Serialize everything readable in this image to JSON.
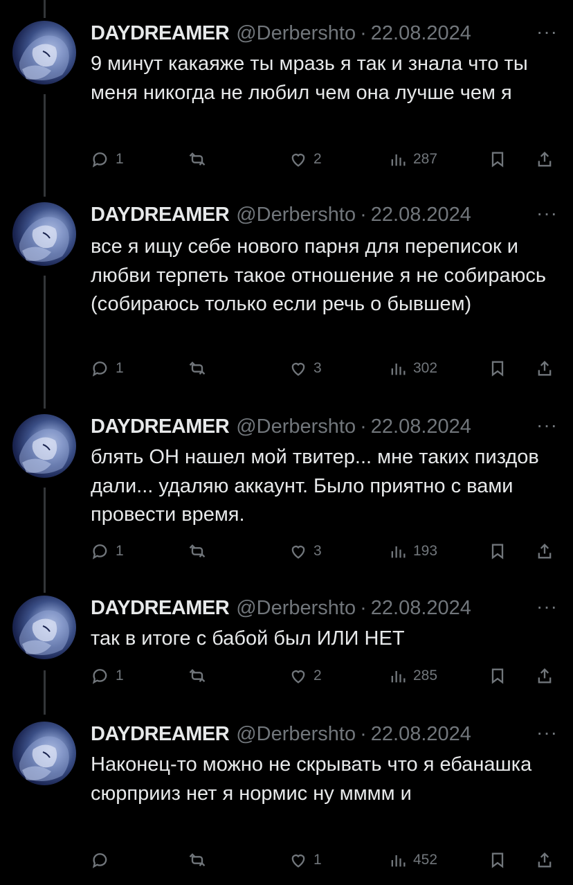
{
  "tweets": [
    {
      "name": "DAYDREAMER",
      "handle": "@Derbershto",
      "dot": "·",
      "date": "22.08.2024",
      "more": "···",
      "text": "9 минут какаяже ты мразь я так и знала что ты меня никогда не любил чем она лучше чем я",
      "replies": "1",
      "likes": "2",
      "views": "287"
    },
    {
      "name": "DAYDREAMER",
      "handle": "@Derbershto",
      "dot": "·",
      "date": "22.08.2024",
      "more": "···",
      "text": "все я ищу себе нового парня для переписок и любви терпеть такое отношение я не собираюсь (собираюсь только если речь о бывшем)",
      "replies": "1",
      "likes": "3",
      "views": "302"
    },
    {
      "name": "DAYDREAMER",
      "handle": "@Derbershto",
      "dot": "·",
      "date": "22.08.2024",
      "more": "···",
      "text": "блять ОН нашел мой твитер... мне таких пиздов дали... удаляю аккаунт. Было приятно с вами провести время.",
      "replies": "1",
      "likes": "3",
      "views": "193"
    },
    {
      "name": "DAYDREAMER",
      "handle": "@Derbershto",
      "dot": "·",
      "date": "22.08.2024",
      "more": "···",
      "text": "так в итоге с бабой был ИЛИ НЕТ",
      "replies": "1",
      "likes": "2",
      "views": "285"
    },
    {
      "name": "DAYDREAMER",
      "handle": "@Derbershto",
      "dot": "·",
      "date": "22.08.2024",
      "more": "···",
      "text": "Наконец-то можно не скрывать что я ебанашка сюрприиз нет я нормис ну мммм и",
      "replies": "",
      "likes": "1",
      "views": "452"
    }
  ],
  "icons": {
    "reply": "reply-icon",
    "retweet": "retweet-icon",
    "like": "heart-icon",
    "views": "views-icon",
    "bookmark": "bookmark-icon",
    "share": "share-icon"
  },
  "colors": {
    "background": "#000000",
    "text": "#e7e9ea",
    "muted": "#71767b",
    "thread": "#333639"
  }
}
